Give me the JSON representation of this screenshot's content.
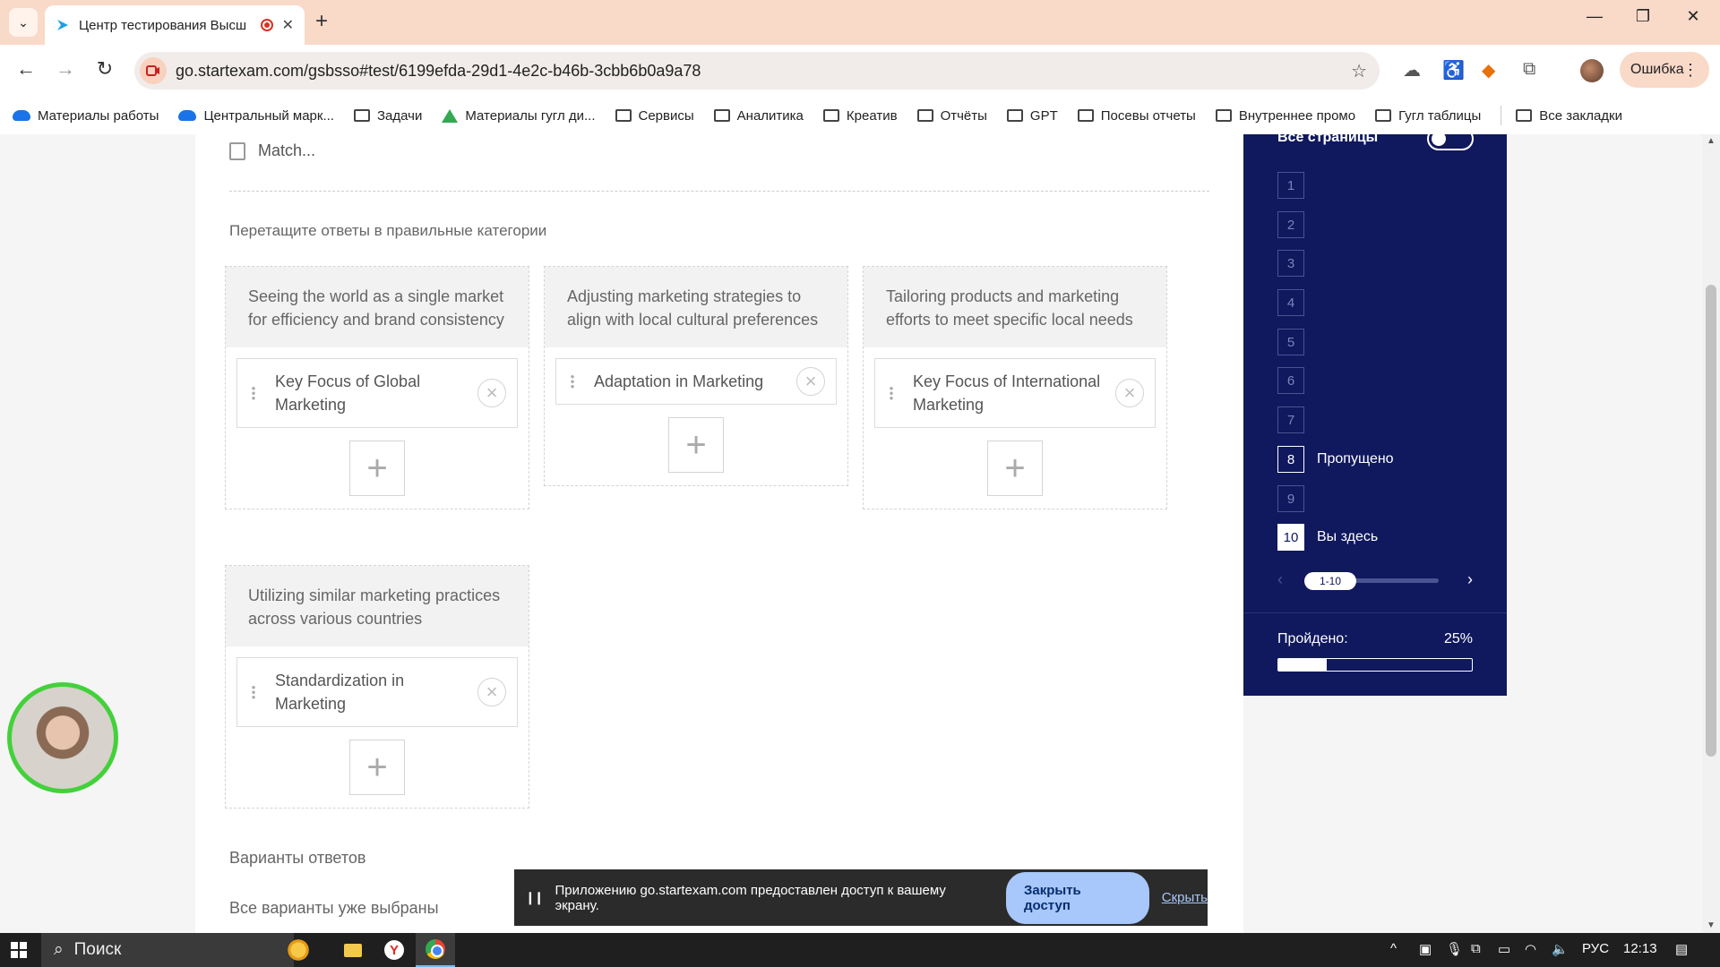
{
  "browser": {
    "tab_title": "Центр тестирования Высш",
    "url": "go.startexam.com/gsbsso#test/6199efda-29d1-4e2c-b46b-3cbb6b0a9a78",
    "profile_status": "Ошибка",
    "bookmarks": [
      {
        "label": "Материалы работы",
        "icon": "cloud-icon"
      },
      {
        "label": "Центральный марк...",
        "icon": "cloud-icon"
      },
      {
        "label": "Задачи",
        "icon": "folder-icon"
      },
      {
        "label": "Материалы гугл ди...",
        "icon": "drive-icon"
      },
      {
        "label": "Сервисы",
        "icon": "folder-icon"
      },
      {
        "label": "Аналитика",
        "icon": "folder-icon"
      },
      {
        "label": "Креатив",
        "icon": "folder-icon"
      },
      {
        "label": "Отчёты",
        "icon": "folder-icon"
      },
      {
        "label": "GPT",
        "icon": "folder-icon"
      },
      {
        "label": "Посевы отчеты",
        "icon": "folder-icon"
      },
      {
        "label": "Внутреннее промо",
        "icon": "folder-icon"
      },
      {
        "label": "Гугл таблицы",
        "icon": "folder-icon"
      }
    ],
    "all_bookmarks": "Все закладки"
  },
  "question": {
    "type_label": "Match...",
    "instruction": "Перетащите ответы в правильные категории",
    "categories": [
      {
        "description": "Seeing the world as a single market for efficiency and brand consistency",
        "answer": "Key Focus of Global Marketing"
      },
      {
        "description": "Adjusting marketing strategies to align with local cultural preferences",
        "answer": "Adaptation in Marketing"
      },
      {
        "description": "Tailoring products and marketing efforts to meet specific local needs",
        "answer": "Key Focus of International Marketing"
      },
      {
        "description": "Utilizing similar marketing practices across various countries",
        "answer": "Standardization in Marketing"
      }
    ],
    "plus_symbol": "+",
    "remove_symbol": "×",
    "answers_header": "Варианты ответов",
    "answers_empty": "Все варианты уже выбраны"
  },
  "navigator": {
    "all_pages_label": "Все страницы",
    "pages": [
      {
        "num": "1",
        "status": ""
      },
      {
        "num": "2",
        "status": ""
      },
      {
        "num": "3",
        "status": ""
      },
      {
        "num": "4",
        "status": ""
      },
      {
        "num": "5",
        "status": ""
      },
      {
        "num": "6",
        "status": ""
      },
      {
        "num": "7",
        "status": ""
      },
      {
        "num": "8",
        "status": "Пропущено"
      },
      {
        "num": "9",
        "status": ""
      },
      {
        "num": "10",
        "status": "Вы здесь"
      }
    ],
    "range_label": "1-10",
    "passed_label": "Пройдено:",
    "passed_value": "25%",
    "passed_fraction": 0.25
  },
  "share_bar": {
    "message": "Приложению go.startexam.com предоставлен доступ к вашему экрану.",
    "stop_button": "Закрыть доступ",
    "hide_link": "Скрыть"
  },
  "taskbar": {
    "search_label": "Поиск",
    "language": "РУС",
    "time": "12:13"
  }
}
